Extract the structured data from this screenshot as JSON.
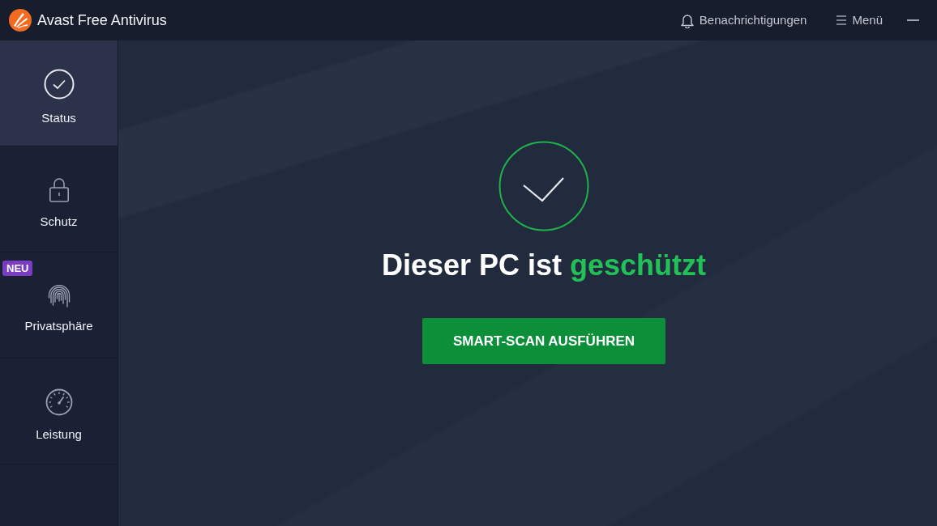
{
  "window": {
    "title": "Avast Free Antivirus"
  },
  "header_actions": [
    {
      "kind": "notifications",
      "label": "Benachrichtigungen"
    },
    {
      "kind": "menu",
      "label": "Menü"
    },
    {
      "kind": "minimize"
    }
  ],
  "sidebar": {
    "items": [
      {
        "kind": "status",
        "label": "Status",
        "selected": true
      },
      {
        "kind": "protection",
        "label": "Schutz",
        "selected": false
      },
      {
        "kind": "privacy",
        "label": "Privatsphäre",
        "selected": false,
        "badge": "NEU"
      },
      {
        "kind": "performance",
        "label": "Leistung",
        "selected": false
      }
    ]
  },
  "status": {
    "heading": "Dieser PC ist",
    "heading_highlight": "geschützt",
    "button": "SMART-SCAN AUSFÜHREN"
  }
}
